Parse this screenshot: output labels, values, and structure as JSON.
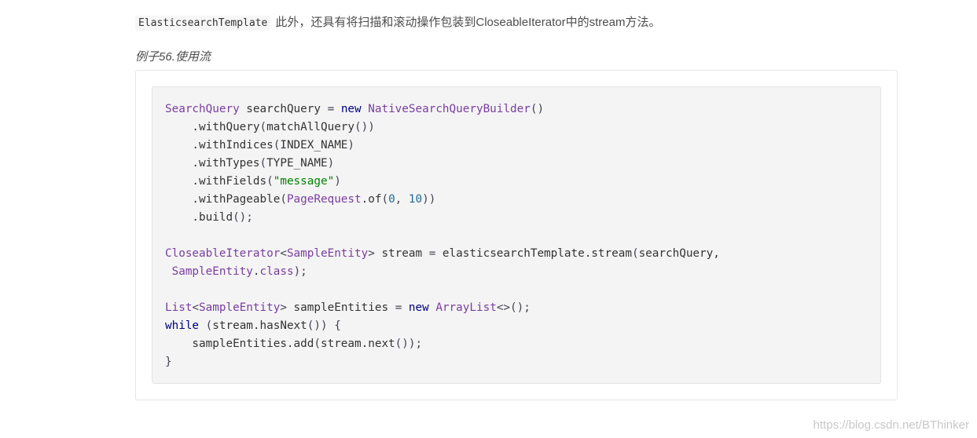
{
  "intro": {
    "code": "ElasticsearchTemplate",
    "text": "此外，还具有将扫描和滚动操作包装到CloseableIterator中的stream方法。"
  },
  "example_title": "例子56.使用流",
  "code_lines": [
    [
      [
        "t",
        "SearchQuery"
      ],
      [
        "p",
        " searchQuery "
      ],
      [
        "s",
        "="
      ],
      [
        "p",
        " "
      ],
      [
        "k",
        "new"
      ],
      [
        "p",
        " "
      ],
      [
        "t",
        "NativeSearchQueryBuilder"
      ],
      [
        "s",
        "()"
      ]
    ],
    [
      [
        "p",
        "    .withQuery"
      ],
      [
        "s",
        "("
      ],
      [
        "p",
        "matchAllQuery"
      ],
      [
        "s",
        "())"
      ]
    ],
    [
      [
        "p",
        "    .withIndices"
      ],
      [
        "s",
        "("
      ],
      [
        "p",
        "INDEX_NAME"
      ],
      [
        "s",
        ")"
      ]
    ],
    [
      [
        "p",
        "    .withTypes"
      ],
      [
        "s",
        "("
      ],
      [
        "p",
        "TYPE_NAME"
      ],
      [
        "s",
        ")"
      ]
    ],
    [
      [
        "p",
        "    .withFields"
      ],
      [
        "s",
        "("
      ],
      [
        "g",
        "\"message\""
      ],
      [
        "s",
        ")"
      ]
    ],
    [
      [
        "p",
        "    .withPageable"
      ],
      [
        "s",
        "("
      ],
      [
        "t",
        "PageRequest"
      ],
      [
        "p",
        ".of"
      ],
      [
        "s",
        "("
      ],
      [
        "n",
        "0"
      ],
      [
        "s",
        ", "
      ],
      [
        "n",
        "10"
      ],
      [
        "s",
        "))"
      ]
    ],
    [
      [
        "p",
        "    .build"
      ],
      [
        "s",
        "();"
      ]
    ],
    [
      [
        "p",
        ""
      ]
    ],
    [
      [
        "t",
        "CloseableIterator"
      ],
      [
        "s",
        "<"
      ],
      [
        "t",
        "SampleEntity"
      ],
      [
        "s",
        ">"
      ],
      [
        "p",
        " stream "
      ],
      [
        "s",
        "="
      ],
      [
        "p",
        " elasticsearchTemplate.stream"
      ],
      [
        "s",
        "("
      ],
      [
        "p",
        "searchQuery,"
      ]
    ],
    [
      [
        "p",
        " "
      ],
      [
        "t",
        "SampleEntity"
      ],
      [
        "p",
        "."
      ],
      [
        "t",
        "class"
      ],
      [
        "s",
        ");"
      ]
    ],
    [
      [
        "p",
        ""
      ]
    ],
    [
      [
        "t",
        "List"
      ],
      [
        "s",
        "<"
      ],
      [
        "t",
        "SampleEntity"
      ],
      [
        "s",
        ">"
      ],
      [
        "p",
        " sampleEntities "
      ],
      [
        "s",
        "="
      ],
      [
        "p",
        " "
      ],
      [
        "k",
        "new"
      ],
      [
        "p",
        " "
      ],
      [
        "t",
        "ArrayList"
      ],
      [
        "s",
        "<>();"
      ]
    ],
    [
      [
        "k",
        "while"
      ],
      [
        "p",
        " "
      ],
      [
        "s",
        "("
      ],
      [
        "p",
        "stream.hasNext"
      ],
      [
        "s",
        "()) {"
      ]
    ],
    [
      [
        "p",
        "    sampleEntities.add"
      ],
      [
        "s",
        "("
      ],
      [
        "p",
        "stream.next"
      ],
      [
        "s",
        "());"
      ]
    ],
    [
      [
        "s",
        "}"
      ]
    ]
  ],
  "watermark": "https://blog.csdn.net/BThinker"
}
